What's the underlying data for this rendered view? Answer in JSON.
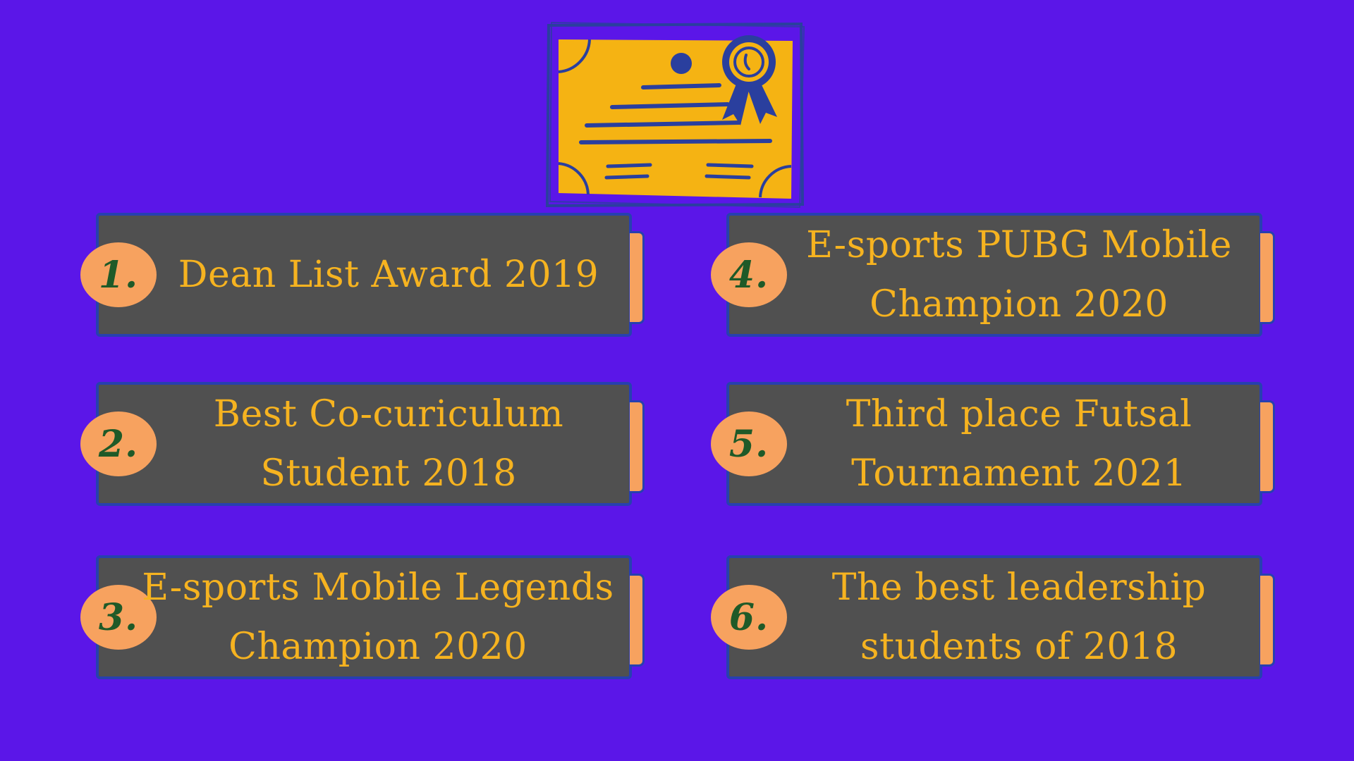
{
  "awards": [
    {
      "number": "1.",
      "text": "Dean List Award 2019"
    },
    {
      "number": "2.",
      "text": "Best Co-curiculum Student 2018"
    },
    {
      "number": "3.",
      "text": "E-sports Mobile Legends Champion 2020"
    },
    {
      "number": "4.",
      "text": "E-sports PUBG Mobile Champion 2020"
    },
    {
      "number": "5.",
      "text": "Third place Futsal Tournament 2021"
    },
    {
      "number": "6.",
      "text": "The best leadership students of 2018"
    }
  ],
  "colors": {
    "background": "#5b16e8",
    "card": "#505050",
    "card_border": "#2740b0",
    "text": "#f6b320",
    "badge": "#f7a25f",
    "badge_text": "#1f5a28",
    "certificate_paper": "#f5b313",
    "certificate_ink": "#2a3f9e"
  },
  "icons": {
    "header": "certificate-icon",
    "seal": "award-ribbon-icon"
  }
}
